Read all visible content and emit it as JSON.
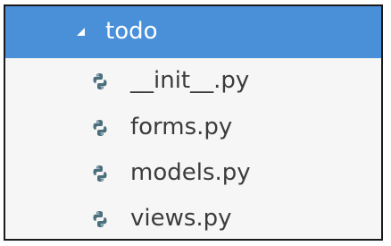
{
  "tree": {
    "folder": {
      "label": "todo",
      "icon": "expanded-triangle-icon",
      "selected_color": "#4a90d9"
    },
    "files": [
      {
        "label": "__init__.py",
        "icon": "python-file-icon"
      },
      {
        "label": "forms.py",
        "icon": "python-file-icon"
      },
      {
        "label": "models.py",
        "icon": "python-file-icon"
      },
      {
        "label": "views.py",
        "icon": "python-file-icon"
      }
    ],
    "python_icon_color": "#4a6f7d"
  }
}
